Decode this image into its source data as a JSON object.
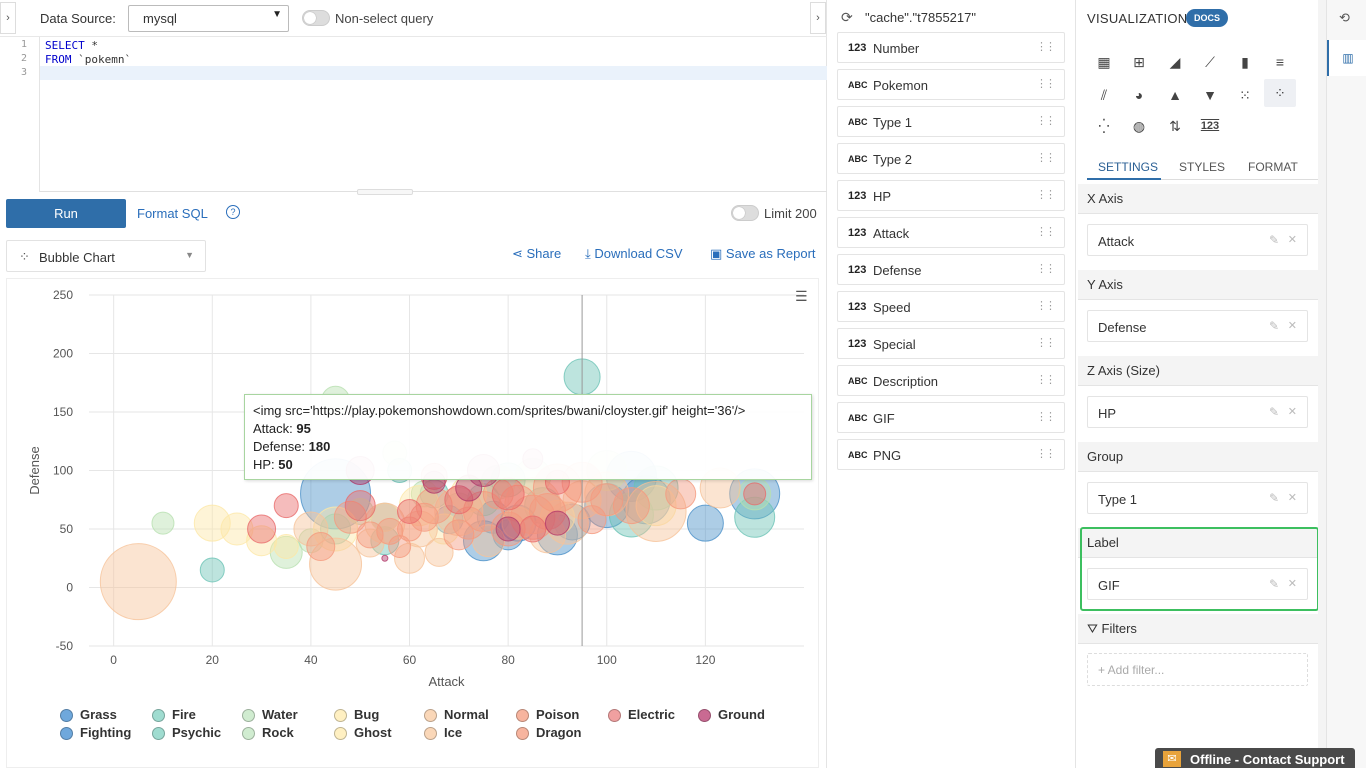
{
  "toolbar": {
    "data_source_label": "Data Source:",
    "data_source_value": "mysql",
    "non_select_label": "Non-select query"
  },
  "editor": {
    "lines": [
      "1",
      "2",
      "3"
    ],
    "code_line1_kw": "SELECT",
    "code_line1_rest": " *",
    "code_line2_kw": "FROM",
    "code_line2_rest": " `pokemn`"
  },
  "run_bar": {
    "run_label": "Run",
    "format_sql_label": "Format SQL",
    "help_glyph": "?",
    "limit_label": "Limit 200"
  },
  "chart_controls": {
    "type_label": "Bubble Chart",
    "share_label": "Share",
    "download_label": "Download CSV",
    "save_label": "Save as Report"
  },
  "tooltip": {
    "header": "<img src='https://play.pokemonshowdown.com/sprites/bwani/cloyster.gif' height='36'/>",
    "rows": [
      {
        "k": "Attack: ",
        "v": "95"
      },
      {
        "k": "Defense: ",
        "v": "180"
      },
      {
        "k": "HP: ",
        "v": "50"
      }
    ]
  },
  "chart_data": {
    "type": "scatter",
    "xlabel": "Attack",
    "ylabel": "Defense",
    "xlim": [
      -5,
      140
    ],
    "ylim": [
      -50,
      250
    ],
    "xticks": [
      0,
      20,
      40,
      60,
      80,
      100,
      120
    ],
    "yticks": [
      -50,
      0,
      50,
      100,
      150,
      200,
      250
    ],
    "crosshair_x": 95,
    "series": [
      {
        "name": "Grass",
        "color": "#4a90c8",
        "points": [
          [
            45,
            80,
            35
          ],
          [
            75,
            40,
            20
          ],
          [
            82,
            55,
            18
          ],
          [
            100,
            70,
            22
          ],
          [
            105,
            95,
            25
          ],
          [
            80,
            45,
            15
          ],
          [
            55,
            60,
            14
          ],
          [
            120,
            55,
            18
          ],
          [
            77,
            60,
            16
          ],
          [
            90,
            45,
            20
          ],
          [
            130,
            80,
            25
          ],
          [
            68,
            58,
            14
          ],
          [
            93,
            56,
            18
          ],
          [
            108,
            75,
            24
          ]
        ]
      },
      {
        "name": "Fire",
        "color": "#6cc3b5",
        "points": [
          [
            20,
            15,
            12
          ],
          [
            95,
            180,
            18
          ],
          [
            45,
            50,
            15
          ],
          [
            110,
            85,
            22
          ],
          [
            130,
            60,
            20
          ],
          [
            87,
            70,
            18
          ],
          [
            65,
            80,
            14
          ],
          [
            75,
            75,
            16
          ],
          [
            105,
            62,
            22
          ],
          [
            58,
            100,
            12
          ],
          [
            80,
            92,
            17
          ],
          [
            55,
            40,
            14
          ]
        ]
      },
      {
        "name": "Water",
        "color": "#b8e0b0",
        "points": [
          [
            10,
            55,
            11
          ],
          [
            45,
            160,
            14
          ],
          [
            35,
            30,
            16
          ],
          [
            100,
            100,
            20
          ],
          [
            50,
            65,
            13
          ],
          [
            130,
            80,
            16
          ],
          [
            40,
            40,
            12
          ],
          [
            85,
            95,
            18
          ],
          [
            70,
            68,
            15
          ],
          [
            63,
            80,
            13
          ],
          [
            78,
            90,
            17
          ],
          [
            57,
            115,
            12
          ]
        ]
      },
      {
        "name": "Bug",
        "color": "#fde7a6",
        "points": [
          [
            20,
            55,
            18
          ],
          [
            25,
            50,
            16
          ],
          [
            30,
            40,
            15
          ],
          [
            45,
            50,
            22
          ],
          [
            62,
            70,
            20
          ],
          [
            72,
            80,
            18
          ],
          [
            90,
            60,
            17
          ],
          [
            110,
            70,
            20
          ],
          [
            55,
            60,
            14
          ],
          [
            35,
            35,
            12
          ],
          [
            82,
            55,
            16
          ],
          [
            67,
            50,
            15
          ]
        ]
      },
      {
        "name": "Normal",
        "color": "#f6c39a",
        "points": [
          [
            5,
            5,
            38
          ],
          [
            45,
            20,
            26
          ],
          [
            55,
            55,
            20
          ],
          [
            70,
            65,
            24
          ],
          [
            85,
            70,
            28
          ],
          [
            100,
            80,
            22
          ],
          [
            110,
            65,
            30
          ],
          [
            62,
            50,
            18
          ],
          [
            76,
            40,
            16
          ],
          [
            92,
            55,
            21
          ],
          [
            123,
            85,
            20
          ],
          [
            40,
            50,
            17
          ],
          [
            52,
            38,
            14
          ],
          [
            60,
            25,
            15
          ],
          [
            95,
            75,
            19
          ],
          [
            66,
            30,
            14
          ],
          [
            88,
            45,
            18
          ]
        ]
      },
      {
        "name": "Poison",
        "color": "#f59a7e",
        "points": [
          [
            42,
            35,
            14
          ],
          [
            48,
            60,
            16
          ],
          [
            52,
            45,
            13
          ],
          [
            60,
            50,
            12
          ],
          [
            65,
            70,
            18
          ],
          [
            70,
            45,
            15
          ],
          [
            75,
            65,
            20
          ],
          [
            80,
            50,
            17
          ],
          [
            85,
            60,
            22
          ],
          [
            90,
            85,
            24
          ],
          [
            95,
            90,
            20
          ],
          [
            100,
            75,
            16
          ],
          [
            105,
            70,
            18
          ],
          [
            115,
            80,
            15
          ],
          [
            58,
            35,
            11
          ],
          [
            63,
            60,
            14
          ],
          [
            72,
            55,
            16
          ],
          [
            88,
            65,
            18
          ],
          [
            78,
            80,
            15
          ],
          [
            56,
            48,
            13
          ],
          [
            82,
            72,
            18
          ],
          [
            97,
            58,
            14
          ]
        ]
      },
      {
        "name": "Electric",
        "color": "#e86b6b",
        "points": [
          [
            30,
            50,
            14
          ],
          [
            35,
            70,
            12
          ],
          [
            50,
            70,
            15
          ],
          [
            65,
            95,
            13
          ],
          [
            80,
            80,
            16
          ],
          [
            90,
            90,
            12
          ],
          [
            130,
            80,
            11
          ],
          [
            70,
            75,
            14
          ],
          [
            60,
            65,
            12
          ],
          [
            85,
            50,
            13
          ]
        ]
      },
      {
        "name": "Ground",
        "color": "#b23a6a",
        "points": [
          [
            55,
            25,
            3
          ],
          [
            50,
            100,
            14
          ],
          [
            75,
            100,
            16
          ],
          [
            80,
            50,
            12
          ],
          [
            85,
            110,
            10
          ],
          [
            90,
            55,
            12
          ],
          [
            65,
            90,
            11
          ],
          [
            72,
            85,
            13
          ]
        ]
      }
    ]
  },
  "legend": [
    {
      "name": "Grass",
      "color": "#6fa8dc"
    },
    {
      "name": "Fire",
      "color": "#9fdcd0"
    },
    {
      "name": "Water",
      "color": "#d0ecd0"
    },
    {
      "name": "Bug",
      "color": "#fff0c2"
    },
    {
      "name": "Normal",
      "color": "#fad7b8"
    },
    {
      "name": "Poison",
      "color": "#f7b49e"
    },
    {
      "name": "Electric",
      "color": "#f0a0a0"
    },
    {
      "name": "Ground",
      "color": "#c96a92"
    },
    {
      "name": "Fighting",
      "color": "#6fa8dc"
    },
    {
      "name": "Psychic",
      "color": "#9fdcd0"
    },
    {
      "name": "Rock",
      "color": "#d0ecd0"
    },
    {
      "name": "Ghost",
      "color": "#fff0c2"
    },
    {
      "name": "Ice",
      "color": "#fad7b8"
    },
    {
      "name": "Dragon",
      "color": "#f7b49e"
    }
  ],
  "middle": {
    "table_name": "\"cache\".\"t7855217\"",
    "fields": [
      {
        "type": "123",
        "name": "Number"
      },
      {
        "type": "ABC",
        "name": "Pokemon"
      },
      {
        "type": "ABC",
        "name": "Type 1"
      },
      {
        "type": "ABC",
        "name": "Type 2"
      },
      {
        "type": "123",
        "name": "HP"
      },
      {
        "type": "123",
        "name": "Attack"
      },
      {
        "type": "123",
        "name": "Defense"
      },
      {
        "type": "123",
        "name": "Speed"
      },
      {
        "type": "123",
        "name": "Special"
      },
      {
        "type": "ABC",
        "name": "Description"
      },
      {
        "type": "ABC",
        "name": "GIF"
      },
      {
        "type": "ABC",
        "name": "PNG"
      }
    ]
  },
  "right": {
    "title": "VISUALIZATION",
    "docs": "DOCS",
    "tabs": [
      "SETTINGS",
      "STYLES",
      "FORMAT"
    ],
    "sections": [
      {
        "head": "X Axis",
        "value": "Attack"
      },
      {
        "head": "Y Axis",
        "value": "Defense"
      },
      {
        "head": "Z Axis (Size)",
        "value": "HP"
      },
      {
        "head": "Group",
        "value": "Type 1"
      },
      {
        "head": "Label",
        "value": "GIF"
      }
    ],
    "filters_head": "Filters",
    "add_filter": "+ Add filter...",
    "viz_icon_numbers": "123"
  },
  "offline": {
    "label": "Offline",
    "sep": " - ",
    "action": "Contact Support"
  }
}
